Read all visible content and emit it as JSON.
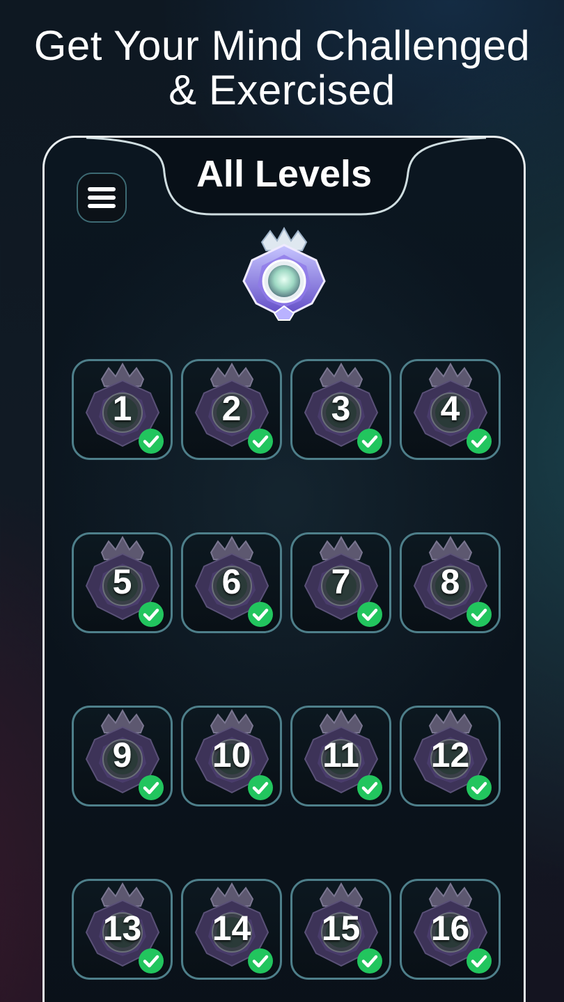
{
  "headline": {
    "line1": "Get Your Mind Challenged",
    "line2": "& Exercised"
  },
  "screen": {
    "title": "All Levels",
    "menu_icon": "hamburger-menu-icon",
    "trophy_icon": "diamond-crown-badge-icon"
  },
  "levels": [
    {
      "label": "1",
      "completed": true
    },
    {
      "label": "2",
      "completed": true
    },
    {
      "label": "3",
      "completed": true
    },
    {
      "label": "4",
      "completed": true
    },
    {
      "label": "5",
      "completed": true
    },
    {
      "label": "6",
      "completed": true
    },
    {
      "label": "7",
      "completed": true
    },
    {
      "label": "8",
      "completed": true
    },
    {
      "label": "9",
      "completed": true
    },
    {
      "label": "10",
      "completed": true
    },
    {
      "label": "11",
      "completed": true
    },
    {
      "label": "12",
      "completed": true
    },
    {
      "label": "13",
      "completed": true
    },
    {
      "label": "14",
      "completed": true
    },
    {
      "label": "15",
      "completed": true
    },
    {
      "label": "16",
      "completed": true
    }
  ],
  "colors": {
    "accent_border": "#4e7f8a",
    "check_green": "#22c55e",
    "text": "#ffffff"
  }
}
